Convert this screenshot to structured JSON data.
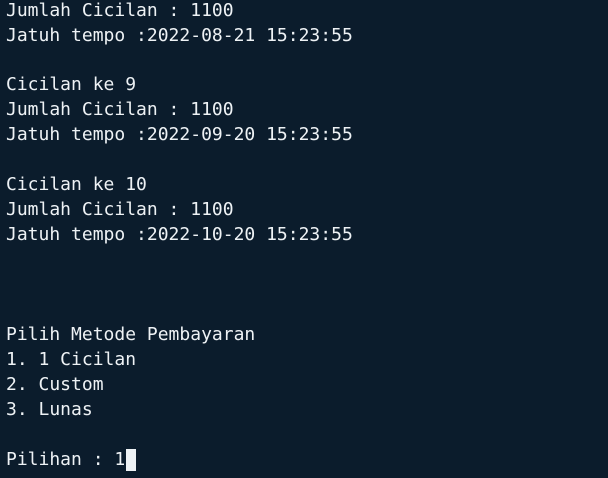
{
  "lines": [
    "Jumlah Cicilan : 1100",
    "Jatuh tempo :2022-08-21 15:23:55",
    "",
    "Cicilan ke 9",
    "Jumlah Cicilan : 1100",
    "Jatuh tempo :2022-09-20 15:23:55",
    "",
    "Cicilan ke 10",
    "Jumlah Cicilan : 1100",
    "Jatuh tempo :2022-10-20 15:23:55",
    "",
    "",
    "",
    "Pilih Metode Pembayaran",
    "1. 1 Cicilan",
    "2. Custom",
    "3. Lunas",
    ""
  ],
  "prompt": {
    "label": "Pilihan : ",
    "value": "1"
  },
  "colors": {
    "background": "#0b1c2c",
    "foreground": "#eef2f5"
  }
}
